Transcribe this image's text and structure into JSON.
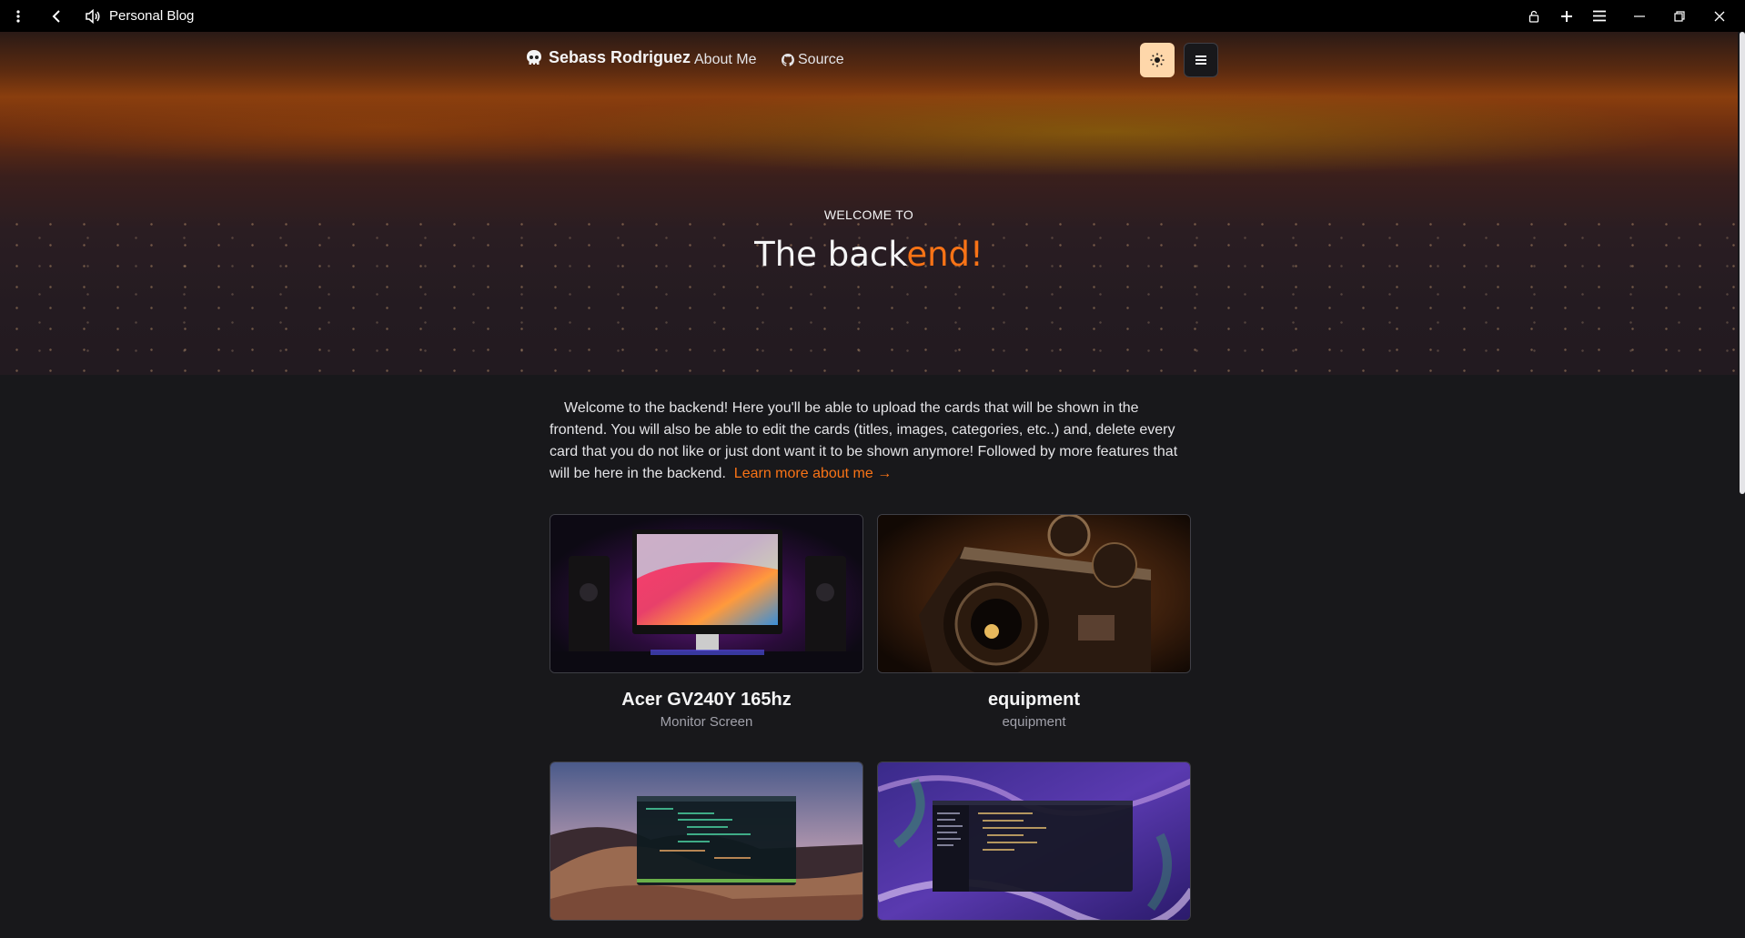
{
  "titlebar": {
    "title": "Personal Blog",
    "icons": [
      "more-vertical-icon",
      "back-arrow-icon",
      "speaker-icon",
      "lock-icon",
      "plus-icon",
      "hamburger-icon",
      "minimize-icon",
      "restore-icon",
      "close-icon"
    ]
  },
  "nav": {
    "brand": "Sebass Rodriguez",
    "about": "About Me",
    "source": "Source",
    "theme_icon": "sun-icon",
    "menu_icon": "list-icon"
  },
  "hero": {
    "subtitle": "WELCOME TO",
    "title_main": "The back",
    "title_accent": "end!"
  },
  "intro": {
    "text": "Welcome to the backend! Here you'll be able to upload the cards that will be shown in the frontend. You will also be able to edit the cards (titles, images, categories, etc..) and, delete every card that you do not like or just dont want it to be shown anymore! Followed by more features that will be here in the backend.",
    "link": "Learn more about me →"
  },
  "cards": [
    {
      "title": "Acer GV240Y 165hz",
      "subtitle": "Monitor Screen",
      "image": "monitor-photo"
    },
    {
      "title": "equipment",
      "subtitle": "equipment",
      "image": "camera-photo"
    },
    {
      "title": "",
      "subtitle": "",
      "image": "desktop-screenshot-dunes"
    },
    {
      "title": "",
      "subtitle": "",
      "image": "desktop-screenshot-purple"
    }
  ],
  "colors": {
    "accent": "#f97316",
    "background": "#18181b",
    "theme_button": "#fed7aa"
  }
}
